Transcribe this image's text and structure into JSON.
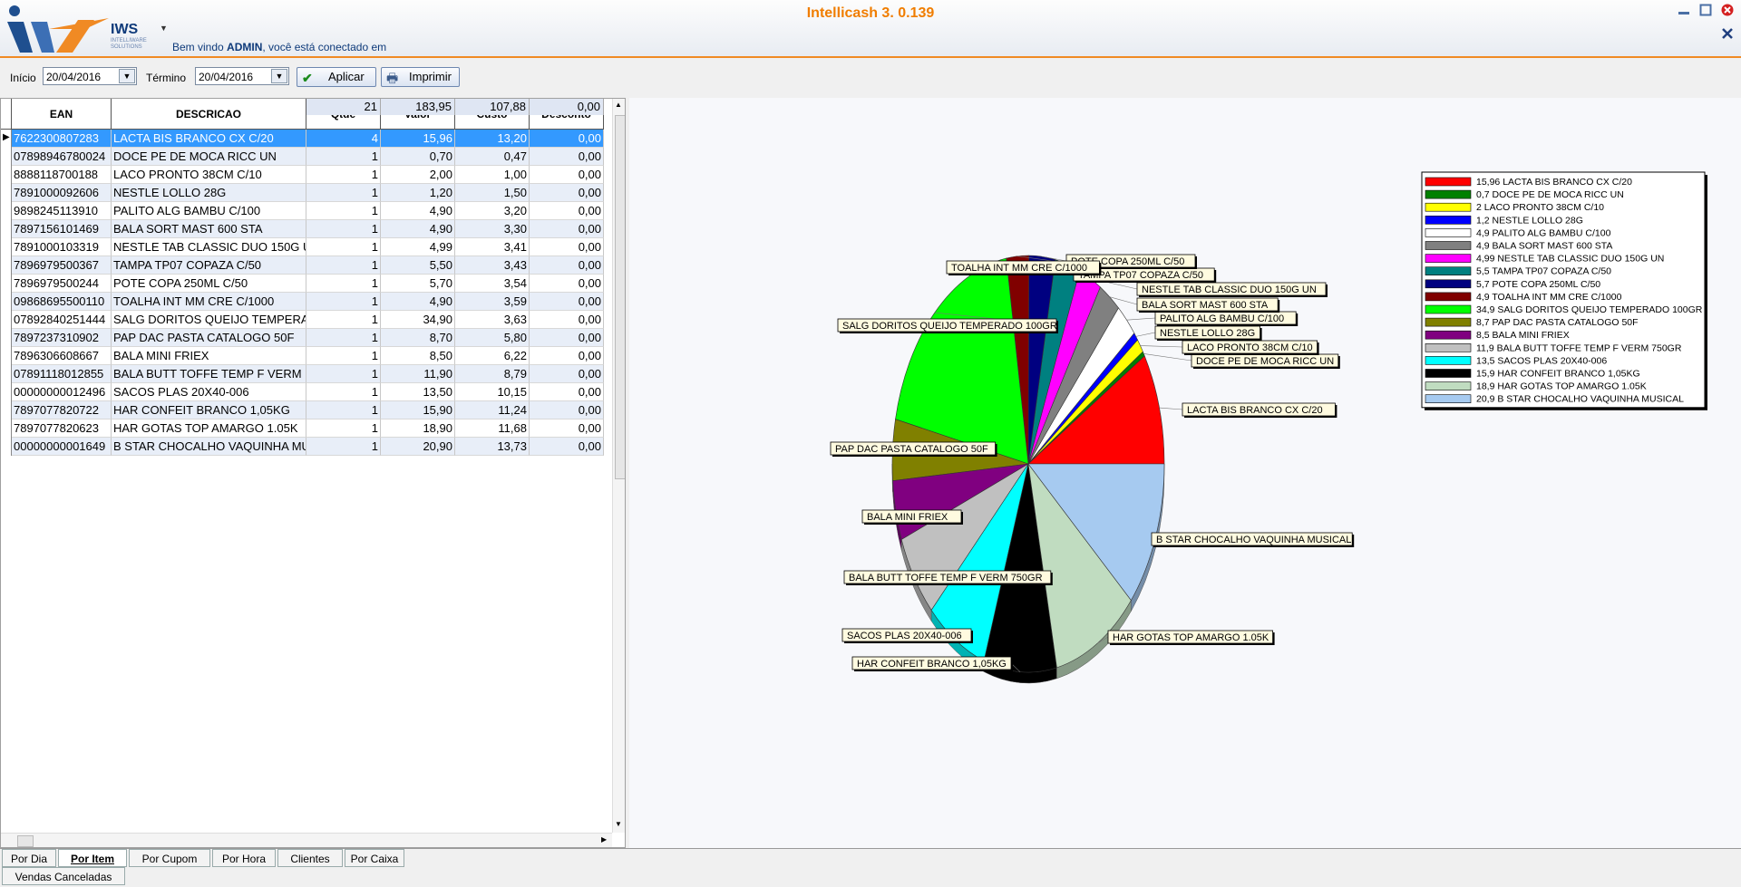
{
  "app": {
    "title": "Intellicash 3. 0.139",
    "brand": "IWS",
    "brand_sub": "INTELLIWARE SOLUTIONS",
    "welcome_prefix": "Bem vindo",
    "welcome_user": "ADMIN",
    "welcome_suffix": ", você está conectado em"
  },
  "toolbar": {
    "start_label": "Início",
    "start_value": "20/04/2016",
    "end_label": "Término",
    "end_value": "20/04/2016",
    "apply_label": "Aplicar",
    "print_label": "Imprimir"
  },
  "grid": {
    "columns": [
      "EAN",
      "DESCRICAO",
      "Qtde",
      "Valor",
      "Custo",
      "Desconto"
    ],
    "rows": [
      [
        "7622300807283",
        "LACTA BIS BRANCO CX C/20",
        "4",
        "15,96",
        "13,20",
        "0,00"
      ],
      [
        "07898946780024",
        "DOCE PE DE MOCA RICC UN",
        "1",
        "0,70",
        "0,47",
        "0,00"
      ],
      [
        "8888118700188",
        "LACO PRONTO 38CM C/10",
        "1",
        "2,00",
        "1,00",
        "0,00"
      ],
      [
        "7891000092606",
        "NESTLE LOLLO 28G",
        "1",
        "1,20",
        "1,50",
        "0,00"
      ],
      [
        "9898245113910",
        "PALITO ALG BAMBU C/100",
        "1",
        "4,90",
        "3,20",
        "0,00"
      ],
      [
        "7897156101469",
        "BALA SORT MAST 600 STA",
        "1",
        "4,90",
        "3,30",
        "0,00"
      ],
      [
        "7891000103319",
        "NESTLE TAB CLASSIC DUO 150G U",
        "1",
        "4,99",
        "3,41",
        "0,00"
      ],
      [
        "7896979500367",
        "TAMPA TP07 COPAZA C/50",
        "1",
        "5,50",
        "3,43",
        "0,00"
      ],
      [
        "7896979500244",
        "POTE COPA 250ML C/50",
        "1",
        "5,70",
        "3,54",
        "0,00"
      ],
      [
        "09868695500110",
        "TOALHA INT MM CRE C/1000",
        "1",
        "4,90",
        "3,59",
        "0,00"
      ],
      [
        "07892840251444",
        "SALG DORITOS QUEIJO TEMPERA",
        "1",
        "34,90",
        "3,63",
        "0,00"
      ],
      [
        "7897237310902",
        "PAP DAC PASTA CATALOGO 50F",
        "1",
        "8,70",
        "5,80",
        "0,00"
      ],
      [
        "7896306608667",
        "BALA MINI FRIEX",
        "1",
        "8,50",
        "6,22",
        "0,00"
      ],
      [
        "07891118012855",
        "BALA BUTT TOFFE TEMP F VERM",
        "1",
        "11,90",
        "8,79",
        "0,00"
      ],
      [
        "00000000012496",
        "SACOS PLAS 20X40-006",
        "1",
        "13,50",
        "10,15",
        "0,00"
      ],
      [
        "7897077820722",
        "HAR CONFEIT BRANCO 1,05KG",
        "1",
        "15,90",
        "11,24",
        "0,00"
      ],
      [
        "7897077820623",
        "HAR GOTAS TOP AMARGO 1.05K",
        "1",
        "18,90",
        "11,68",
        "0,00"
      ],
      [
        "00000000001649",
        "B STAR CHOCALHO VAQUINHA MU",
        "1",
        "20,90",
        "13,73",
        "0,00"
      ]
    ],
    "totals": [
      "21",
      "183,95",
      "107,88",
      "0,00"
    ]
  },
  "chart_data": {
    "type": "pie",
    "series": [
      {
        "values": [
          15.96,
          0.7,
          2,
          1.2,
          4.9,
          4.9,
          4.99,
          5.5,
          5.7,
          4.9,
          34.9,
          8.7,
          8.5,
          11.9,
          13.5,
          15.9,
          18.9,
          20.9
        ]
      }
    ],
    "categories": [
      "LACTA BIS BRANCO CX C/20",
      "DOCE PE DE MOCA RICC UN",
      "LACO PRONTO 38CM C/10",
      "NESTLE LOLLO 28G",
      "PALITO ALG BAMBU C/100",
      "BALA SORT MAST 600 STA",
      "NESTLE TAB CLASSIC DUO 150G UN",
      "TAMPA TP07 COPAZA C/50",
      "POTE COPA 250ML C/50",
      "TOALHA INT MM CRE C/1000",
      "SALG DORITOS QUEIJO TEMPERADO 100GR",
      "PAP DAC PASTA CATALOGO 50F",
      "BALA MINI FRIEX",
      "BALA BUTT TOFFE TEMP F VERM 750GR",
      "SACOS PLAS 20X40-006",
      "HAR CONFEIT BRANCO 1,05KG",
      "HAR GOTAS TOP AMARGO 1.05K",
      "B STAR CHOCALHO VAQUINHA MUSICAL"
    ],
    "legend_labels": [
      "15,96",
      "0,7",
      "2",
      "1,2",
      "4,9",
      "4,9",
      "4,99",
      "5,5",
      "5,7",
      "4,9",
      "34,9",
      "8,7",
      "8,5",
      "11,9",
      "13,5",
      "15,9",
      "18,9",
      "20,9"
    ],
    "colors": [
      "#ff0000",
      "#008000",
      "#ffff00",
      "#0000ff",
      "#ffffff",
      "#808080",
      "#ff00ff",
      "#008080",
      "#000080",
      "#800000",
      "#00ff00",
      "#808000",
      "#800080",
      "#c0c0c0",
      "#00ffff",
      "#000000",
      "#c0dcc0",
      "#a6caf0"
    ],
    "legend_position": "top-right",
    "title": ""
  },
  "tabs": [
    "Por Dia",
    "Por Item",
    "Por Cupom",
    "Por Hora",
    "Clientes",
    "Por Caixa"
  ],
  "tabs2": [
    "Vendas Canceladas"
  ]
}
